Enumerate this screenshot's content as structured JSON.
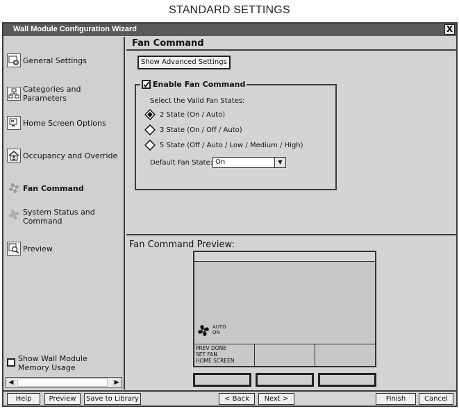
{
  "page_heading": "STANDARD SETTINGS",
  "window": {
    "title": "Wall Module Configuration Wizard",
    "close_label": "X"
  },
  "sidebar": {
    "items": [
      {
        "label": "General Settings",
        "icon": "settings-icon"
      },
      {
        "label": "Categories and Parameters",
        "icon": "hierarchy-icon"
      },
      {
        "label": "Home Screen Options",
        "icon": "monitor-icon"
      },
      {
        "label": "Occupancy and Override",
        "icon": "house-icon"
      },
      {
        "label": "Fan Command",
        "icon": "fan-icon",
        "active": true
      },
      {
        "label": "System Status and Command",
        "icon": "status-icon"
      },
      {
        "label": "Preview",
        "icon": "preview-icon"
      }
    ],
    "memory_usage_label": "Show Wall Module Memory Usage",
    "memory_usage_checked": false
  },
  "fan_command": {
    "title": "Fan Command",
    "advanced_button": "Show Advanced Settings",
    "enable_label": "Enable Fan Command",
    "enable_checked": true,
    "states_prompt": "Select the Valid Fan States:",
    "state_options": [
      {
        "label": "2 State (On / Auto)",
        "selected": true
      },
      {
        "label": "3 State (On / Off / Auto)",
        "selected": false
      },
      {
        "label": "5 State (Off / Auto / Low / Medium / High)",
        "selected": false
      }
    ],
    "default_state_label": "Default Fan State:",
    "default_state_value": "On"
  },
  "preview": {
    "title": "Fan Command Preview:",
    "fan_state_top": "AUTO",
    "fan_state_bottom": "ON",
    "softkey_line1": "PREV DONE",
    "softkey_line2": "SET  FAN",
    "softkey_line3": "HOME SCREEN"
  },
  "footer": {
    "help": "Help",
    "preview": "Preview",
    "save": "Save to Library",
    "back": "< Back",
    "next": "Next >",
    "finish": "Finish",
    "cancel": "Cancel"
  }
}
